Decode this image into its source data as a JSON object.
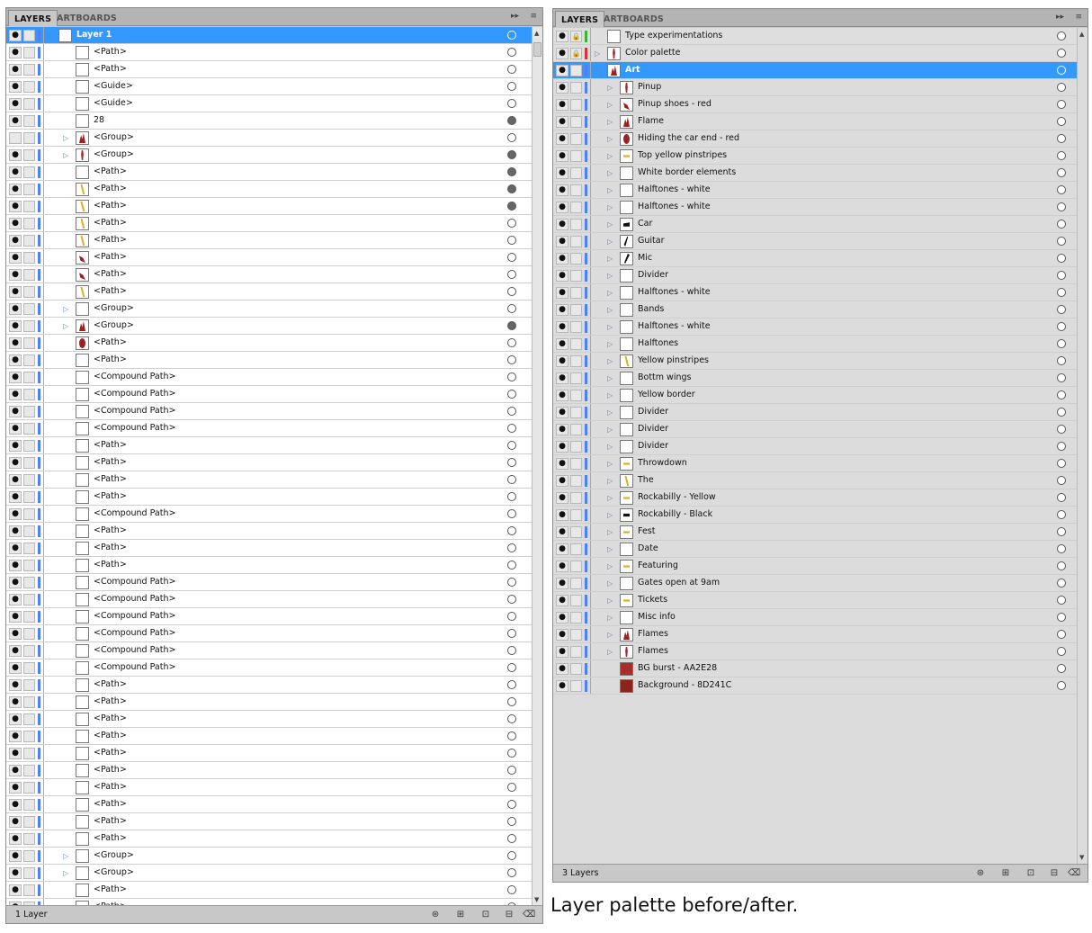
{
  "left_panel": {
    "tabs": {
      "layers": "LAYERS",
      "artboards": "ARTBOARDS"
    },
    "footer": {
      "count": "1 Layer"
    },
    "rows": [
      {
        "name": "Layer 1",
        "kind": "layer",
        "expand": "open",
        "target": "hollow",
        "thumb": "blank"
      },
      {
        "name": "<Path>",
        "target": "hollow",
        "thumb": "blank"
      },
      {
        "name": "<Path>",
        "target": "hollow",
        "thumb": "blank"
      },
      {
        "name": "<Guide>",
        "target": "hollow",
        "thumb": "blank"
      },
      {
        "name": "<Guide>",
        "target": "hollow",
        "thumb": "blank"
      },
      {
        "name": "28",
        "target": "filled",
        "thumb": "blank"
      },
      {
        "name": "<Group>",
        "expand": "closed",
        "target": "hollow",
        "thumb": "flame-red",
        "hidden": true
      },
      {
        "name": "<Group>",
        "expand": "closed",
        "target": "filled",
        "thumb": "figure-red"
      },
      {
        "name": "<Path>",
        "target": "filled",
        "thumb": "blank"
      },
      {
        "name": "<Path>",
        "target": "filled",
        "thumb": "yellow-stroke"
      },
      {
        "name": "<Path>",
        "target": "filled",
        "thumb": "yellow-stroke"
      },
      {
        "name": "<Path>",
        "target": "hollow",
        "thumb": "yellow-stroke"
      },
      {
        "name": "<Path>",
        "target": "hollow",
        "thumb": "yellow-stroke"
      },
      {
        "name": "<Path>",
        "target": "hollow",
        "thumb": "shoe-red"
      },
      {
        "name": "<Path>",
        "target": "hollow",
        "thumb": "shoe-red"
      },
      {
        "name": "<Path>",
        "target": "hollow",
        "thumb": "yellow-stroke"
      },
      {
        "name": "<Group>",
        "expand": "closed",
        "target": "hollow",
        "thumb": "blank"
      },
      {
        "name": "<Group>",
        "expand": "closed",
        "target": "filled",
        "thumb": "flame-red"
      },
      {
        "name": "<Path>",
        "target": "hollow",
        "thumb": "blob-red"
      },
      {
        "name": "<Path>",
        "target": "hollow",
        "thumb": "blank"
      },
      {
        "name": "<Compound Path>",
        "target": "hollow",
        "thumb": "blank"
      },
      {
        "name": "<Compound Path>",
        "target": "hollow",
        "thumb": "blank"
      },
      {
        "name": "<Compound Path>",
        "target": "hollow",
        "thumb": "blank"
      },
      {
        "name": "<Compound Path>",
        "target": "hollow",
        "thumb": "blank"
      },
      {
        "name": "<Path>",
        "target": "hollow",
        "thumb": "blank"
      },
      {
        "name": "<Path>",
        "target": "hollow",
        "thumb": "blank"
      },
      {
        "name": "<Path>",
        "target": "hollow",
        "thumb": "blank"
      },
      {
        "name": "<Path>",
        "target": "hollow",
        "thumb": "blank"
      },
      {
        "name": "<Compound Path>",
        "target": "hollow",
        "thumb": "blank"
      },
      {
        "name": "<Path>",
        "target": "hollow",
        "thumb": "blank"
      },
      {
        "name": "<Path>",
        "target": "hollow",
        "thumb": "blank"
      },
      {
        "name": "<Path>",
        "target": "hollow",
        "thumb": "blank"
      },
      {
        "name": "<Compound Path>",
        "target": "hollow",
        "thumb": "blank"
      },
      {
        "name": "<Compound Path>",
        "target": "hollow",
        "thumb": "blank"
      },
      {
        "name": "<Compound Path>",
        "target": "hollow",
        "thumb": "blank"
      },
      {
        "name": "<Compound Path>",
        "target": "hollow",
        "thumb": "blank"
      },
      {
        "name": "<Compound Path>",
        "target": "hollow",
        "thumb": "blank"
      },
      {
        "name": "<Compound Path>",
        "target": "hollow",
        "thumb": "blank"
      },
      {
        "name": "<Path>",
        "target": "hollow",
        "thumb": "blank"
      },
      {
        "name": "<Path>",
        "target": "hollow",
        "thumb": "blank"
      },
      {
        "name": "<Path>",
        "target": "hollow",
        "thumb": "blank"
      },
      {
        "name": "<Path>",
        "target": "hollow",
        "thumb": "blank"
      },
      {
        "name": "<Path>",
        "target": "hollow",
        "thumb": "blank"
      },
      {
        "name": "<Path>",
        "target": "hollow",
        "thumb": "blank"
      },
      {
        "name": "<Path>",
        "target": "hollow",
        "thumb": "blank"
      },
      {
        "name": "<Path>",
        "target": "hollow",
        "thumb": "blank"
      },
      {
        "name": "<Path>",
        "target": "hollow",
        "thumb": "blank"
      },
      {
        "name": "<Path>",
        "target": "hollow",
        "thumb": "blank"
      },
      {
        "name": "<Group>",
        "expand": "closed",
        "target": "hollow",
        "thumb": "blank"
      },
      {
        "name": "<Group>",
        "expand": "closed",
        "target": "hollow",
        "thumb": "blank"
      },
      {
        "name": "<Path>",
        "target": "hollow",
        "thumb": "blank"
      },
      {
        "name": "<Path>",
        "target": "hollow",
        "thumb": "blank"
      }
    ]
  },
  "right_panel": {
    "tabs": {
      "layers": "LAYERS",
      "artboards": "ARTBOARDS"
    },
    "footer": {
      "count": "3 Layers"
    },
    "rows": [
      {
        "name": "Type experimentations",
        "kind": "layer",
        "locked": true,
        "color": "#3cb43c",
        "target": "hollow",
        "thumb": "blank",
        "grey": true
      },
      {
        "name": "Color palette",
        "kind": "layer",
        "locked": true,
        "color": "#e03030",
        "expand": "closed",
        "target": "hollow",
        "thumb": "figure-red",
        "grey": true
      },
      {
        "name": "Art",
        "kind": "layer",
        "expand": "open",
        "target": "hollow",
        "thumb": "flame-red"
      },
      {
        "name": "Pinup",
        "expand": "closed",
        "target": "hollow",
        "thumb": "figure-red"
      },
      {
        "name": "Pinup shoes - red",
        "expand": "closed",
        "target": "hollow",
        "thumb": "shoe-red"
      },
      {
        "name": "Flame",
        "expand": "closed",
        "target": "hollow",
        "thumb": "flame-red"
      },
      {
        "name": "Hiding the car end - red",
        "expand": "closed",
        "target": "hollow",
        "thumb": "blob-red"
      },
      {
        "name": "Top yellow pinstripes",
        "expand": "closed",
        "target": "hollow",
        "thumb": "yellow-line"
      },
      {
        "name": "White border elements",
        "expand": "closed",
        "target": "hollow",
        "thumb": "blank"
      },
      {
        "name": "Halftones - white",
        "expand": "closed",
        "target": "hollow",
        "thumb": "blank"
      },
      {
        "name": "Halftones - white",
        "expand": "closed",
        "target": "hollow",
        "thumb": "blank"
      },
      {
        "name": "Car",
        "expand": "closed",
        "target": "hollow",
        "thumb": "car-black"
      },
      {
        "name": "Guitar",
        "expand": "closed",
        "target": "hollow",
        "thumb": "guitar-black"
      },
      {
        "name": "Mic",
        "expand": "closed",
        "target": "hollow",
        "thumb": "mic-black"
      },
      {
        "name": "Divider",
        "expand": "closed",
        "target": "hollow",
        "thumb": "blank"
      },
      {
        "name": "Halftones - white",
        "expand": "closed",
        "target": "hollow",
        "thumb": "blank"
      },
      {
        "name": "Bands",
        "expand": "closed",
        "target": "hollow",
        "thumb": "blank"
      },
      {
        "name": "Halftones - white",
        "expand": "closed",
        "target": "hollow",
        "thumb": "blank"
      },
      {
        "name": "Halftones",
        "expand": "closed",
        "target": "hollow",
        "thumb": "blank"
      },
      {
        "name": "Yellow pinstripes",
        "expand": "closed",
        "target": "hollow",
        "thumb": "yellow-stroke"
      },
      {
        "name": "Bottm wings",
        "expand": "closed",
        "target": "hollow",
        "thumb": "blank"
      },
      {
        "name": "Yellow border",
        "expand": "closed",
        "target": "hollow",
        "thumb": "blank"
      },
      {
        "name": "Divider",
        "expand": "closed",
        "target": "hollow",
        "thumb": "blank"
      },
      {
        "name": "Divider",
        "expand": "closed",
        "target": "hollow",
        "thumb": "blank"
      },
      {
        "name": "Divider",
        "expand": "closed",
        "target": "hollow",
        "thumb": "blank"
      },
      {
        "name": "Throwdown",
        "expand": "closed",
        "target": "hollow",
        "thumb": "yellow-line"
      },
      {
        "name": "The",
        "expand": "closed",
        "target": "hollow",
        "thumb": "yellow-stroke"
      },
      {
        "name": "Rockabilly - Yellow",
        "expand": "closed",
        "target": "hollow",
        "thumb": "yellow-line"
      },
      {
        "name": "Rockabilly - Black",
        "expand": "closed",
        "target": "hollow",
        "thumb": "black-line"
      },
      {
        "name": "Fest",
        "expand": "closed",
        "target": "hollow",
        "thumb": "yellow-line"
      },
      {
        "name": "Date",
        "expand": "closed",
        "target": "hollow",
        "thumb": "blank"
      },
      {
        "name": "Featuring",
        "expand": "closed",
        "target": "hollow",
        "thumb": "yellow-line"
      },
      {
        "name": "Gates open at 9am",
        "expand": "closed",
        "target": "hollow",
        "thumb": "blank"
      },
      {
        "name": "Tickets",
        "expand": "closed",
        "target": "hollow",
        "thumb": "yellow-line"
      },
      {
        "name": "Misc info",
        "expand": "closed",
        "target": "hollow",
        "thumb": "blank"
      },
      {
        "name": "Flames",
        "expand": "closed",
        "target": "hollow",
        "thumb": "flame-red"
      },
      {
        "name": "Flames",
        "expand": "closed",
        "target": "hollow",
        "thumb": "figure-red"
      },
      {
        "name": "BG burst - AA2E28",
        "target": "hollow",
        "thumb": "solid-AA2E28"
      },
      {
        "name": "Background - 8D241C",
        "target": "hollow",
        "thumb": "solid-8D241C"
      }
    ]
  },
  "caption": "Layer palette before/after.",
  "colors": {
    "selection": "#3399ff",
    "layer_color_blue": "#4d7fff",
    "panel_bg": "#c8c8c8"
  }
}
